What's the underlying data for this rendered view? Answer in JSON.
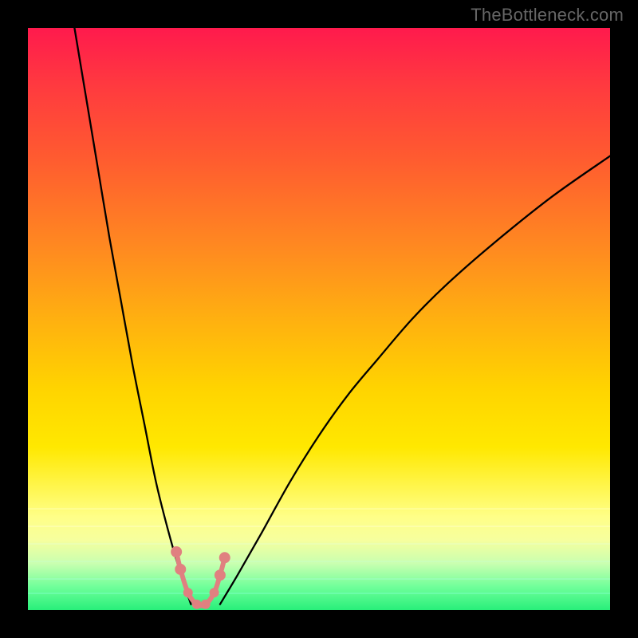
{
  "watermark": "TheBottleneck.com",
  "chart_data": {
    "type": "line",
    "title": "",
    "xlabel": "",
    "ylabel": "",
    "xlim": [
      0,
      100
    ],
    "ylim": [
      0,
      100
    ],
    "grid": false,
    "legend": false,
    "background_gradient": {
      "top": "#ff1a4d",
      "bottom": "#28ef7a",
      "meaning": "color scale from high bottleneck (red, top) to optimal (green, bottom)"
    },
    "series": [
      {
        "name": "left-branch",
        "x": [
          8,
          10,
          12,
          14,
          16,
          18,
          20,
          22,
          24,
          26,
          28
        ],
        "y": [
          100,
          88,
          76,
          64,
          53,
          42,
          32,
          22,
          14,
          7,
          1
        ]
      },
      {
        "name": "right-branch",
        "x": [
          33,
          36,
          40,
          45,
          50,
          55,
          60,
          66,
          72,
          80,
          90,
          100
        ],
        "y": [
          1,
          6,
          13,
          22,
          30,
          37,
          43,
          50,
          56,
          63,
          71,
          78
        ]
      },
      {
        "name": "highlight-segment",
        "x": [
          25.5,
          26.2,
          27.5,
          29.0,
          30.5,
          32.0,
          33.0,
          33.8
        ],
        "y": [
          10,
          7,
          3,
          1,
          1,
          3,
          6,
          9
        ]
      }
    ],
    "annotations": []
  }
}
